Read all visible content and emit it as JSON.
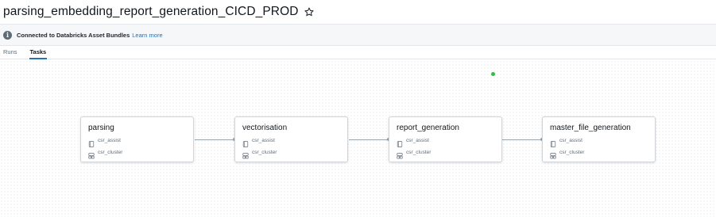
{
  "job": {
    "title": "parsing_embedding_report_generation_CICD_PROD"
  },
  "banner": {
    "text": "Connected to Databricks Asset Bundles",
    "link": "Learn more"
  },
  "tabs": [
    {
      "label": "Runs",
      "active": false
    },
    {
      "label": "Tasks",
      "active": true
    }
  ],
  "icons": {
    "star": "star-outline-icon",
    "info": "info-icon",
    "notebook": "notebook-icon",
    "cluster": "cluster-icon"
  },
  "status_color": "#2fbe3f",
  "accent_color": "#2272b4",
  "tasks": [
    {
      "name": "parsing",
      "path": "csr_assist",
      "cluster": "csr_cluster"
    },
    {
      "name": "vectorisation",
      "path": "csr_assist",
      "cluster": "csr_cluster"
    },
    {
      "name": "report_generation",
      "path": "csr_assist",
      "cluster": "csr_cluster"
    },
    {
      "name": "master_file_generation",
      "path": "csr_assist",
      "cluster": "csr_cluster"
    }
  ]
}
